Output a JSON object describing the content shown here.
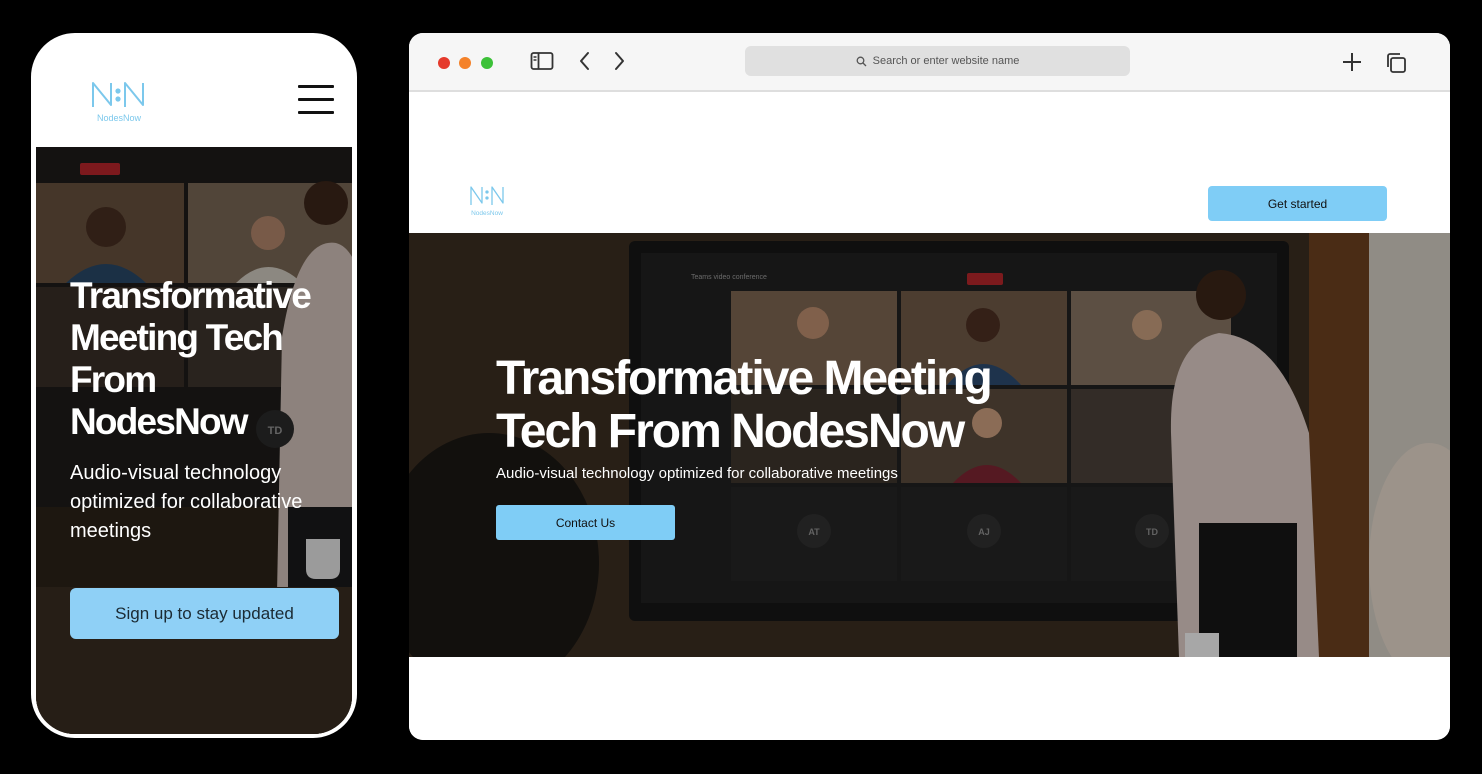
{
  "mobile": {
    "brand": "NodesNow",
    "menu_icon": "hamburger-menu-icon",
    "hero": {
      "title": "Transformative Meeting Tech From NodesNow",
      "subtitle": "Audio-visual technology optimized for collaborative meetings",
      "cta_label": "Sign up to stay updated",
      "avatar_initials": "TD"
    }
  },
  "browser": {
    "window_controls": [
      "close",
      "minimize",
      "maximize"
    ],
    "toolbar_icons": [
      "sidebar-icon",
      "back-icon",
      "forward-icon",
      "new-tab-icon",
      "tabs-icon"
    ],
    "address_placeholder": "Search or enter website name",
    "site": {
      "brand": "NodesNow",
      "header_cta": "Get started",
      "hero": {
        "title": "Transformative Meeting Tech From NodesNow",
        "subtitle": "Audio-visual technology optimized for collaborative meetings",
        "cta_label": "Contact Us",
        "screen_caption": "Teams video conference",
        "participant_initials": [
          "AT",
          "AJ",
          "TD"
        ]
      }
    }
  },
  "colors": {
    "accent": "#7fcdf6",
    "logo": "#7cc8ec",
    "dot_red": "#e53a2c",
    "dot_orange": "#f4822a",
    "dot_green": "#3cc138"
  }
}
